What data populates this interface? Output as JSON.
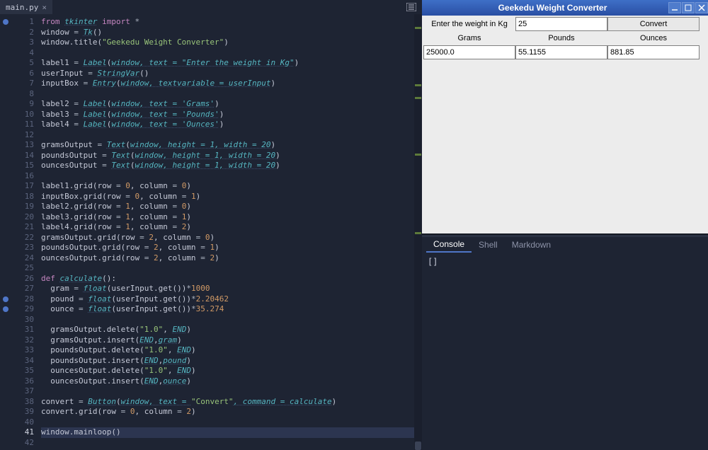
{
  "editor": {
    "tab_name": "main.py",
    "current_line": 41,
    "breakpoints": [
      1,
      28,
      29
    ],
    "scrollbar": {
      "marks_pct": [
        3,
        16,
        19,
        32,
        50
      ],
      "thumb_top_pct": 98,
      "thumb_height_pct": 2
    },
    "lines": [
      {
        "n": 1,
        "html": "<span class='kw'>from</span> <span class='fn'>tkinter</span> <span class='kw'>import</span> <span class='op'>*</span>"
      },
      {
        "n": 2,
        "html": "window <span class='op'>=</span> <span class='fn'>Tk</span>()"
      },
      {
        "n": 3,
        "html": "window.title(<span class='str'>\"Geekedu Weight Converter\"</span>)"
      },
      {
        "n": 4,
        "html": ""
      },
      {
        "n": 5,
        "html": "label1 <span class='op'>=</span> <span class='fn'>Label</span>(<span class='fn ul'>window, text = \"Enter the weight in Kg\"</span>)"
      },
      {
        "n": 6,
        "html": "userInput <span class='op'>=</span> <span class='fn'>StringVar</span>()"
      },
      {
        "n": 7,
        "html": "inputBox <span class='op'>=</span> <span class='fn'>Entry</span>(<span class='fn ul'>window, textvariable = userInput</span>)"
      },
      {
        "n": 8,
        "html": ""
      },
      {
        "n": 9,
        "html": "label2 <span class='op'>=</span> <span class='fn'>Label</span>(<span class='fn ul'>window, text = 'Grams'</span>)"
      },
      {
        "n": 10,
        "html": "label3 <span class='op'>=</span> <span class='fn'>Label</span>(<span class='fn ul'>window, text = 'Pounds'</span>)"
      },
      {
        "n": 11,
        "html": "label4 <span class='op'>=</span> <span class='fn'>Label</span>(<span class='fn ul'>window, text = 'Ounces'</span>)"
      },
      {
        "n": 12,
        "html": ""
      },
      {
        "n": 13,
        "html": "gramsOutput <span class='op'>=</span> <span class='fn'>Text</span>(<span class='fn ul'>window, height = 1, width = 20</span>)"
      },
      {
        "n": 14,
        "html": "poundsOutput <span class='op'>=</span> <span class='fn'>Text</span>(<span class='fn ul'>window, height = 1, width = 20</span>)"
      },
      {
        "n": 15,
        "html": "ouncesOutput <span class='op'>=</span> <span class='fn'>Text</span>(<span class='fn ul'>window, height = 1, width = 20</span>)"
      },
      {
        "n": 16,
        "html": ""
      },
      {
        "n": 17,
        "html": "label1.grid(row <span class='op'>=</span> <span class='num'>0</span>, column <span class='op'>=</span> <span class='num'>0</span>)"
      },
      {
        "n": 18,
        "html": "inputBox.grid(row <span class='op'>=</span> <span class='num'>0</span>, column <span class='op'>=</span> <span class='num'>1</span>)"
      },
      {
        "n": 19,
        "html": "label2.grid(row <span class='op'>=</span> <span class='num'>1</span>, column <span class='op'>=</span> <span class='num'>0</span>)"
      },
      {
        "n": 20,
        "html": "label3.grid(row <span class='op'>=</span> <span class='num'>1</span>, column <span class='op'>=</span> <span class='num'>1</span>)"
      },
      {
        "n": 21,
        "html": "label4.grid(row <span class='op'>=</span> <span class='num'>1</span>, column <span class='op'>=</span> <span class='num'>2</span>)"
      },
      {
        "n": 22,
        "html": "gramsOutput.grid(row <span class='op'>=</span> <span class='num'>2</span>, column <span class='op'>=</span> <span class='num'>0</span>)"
      },
      {
        "n": 23,
        "html": "poundsOutput.grid(row <span class='op'>=</span> <span class='num'>2</span>, column <span class='op'>=</span> <span class='num'>1</span>)"
      },
      {
        "n": 24,
        "html": "ouncesOutput.grid(row <span class='op'>=</span> <span class='num'>2</span>, column <span class='op'>=</span> <span class='num'>2</span>)"
      },
      {
        "n": 25,
        "html": ""
      },
      {
        "n": 26,
        "html": "<span class='kw'>def</span> <span class='fn'>calculate</span>():"
      },
      {
        "n": 27,
        "html": "  gram <span class='op'>=</span> <span class='fn'>float</span>(userInput.get())<span class='op'>*</span><span class='num'>1000</span>"
      },
      {
        "n": 28,
        "html": "  pound <span class='op'>=</span> <span class='fn'>float</span>(userInput.get())<span class='op'>*</span><span class='num'>2.20462</span>"
      },
      {
        "n": 29,
        "html": "  ounce <span class='op'>=</span> <span class='fn'>float</span>(userInput.get())<span class='op'>*</span><span class='num'>35.274</span>"
      },
      {
        "n": 30,
        "html": ""
      },
      {
        "n": 31,
        "html": "  gramsOutput.delete(<span class='str'>\"1.0\"</span>, <span class='fn ul'>END</span>)"
      },
      {
        "n": 32,
        "html": "  gramsOutput.insert(<span class='fn ul'>END</span>,<span class='fn ul'>gram</span>)"
      },
      {
        "n": 33,
        "html": "  poundsOutput.delete(<span class='str'>\"1.0\"</span>, <span class='fn ul'>END</span>)"
      },
      {
        "n": 34,
        "html": "  poundsOutput.insert(<span class='fn ul'>END</span>,<span class='fn ul'>pound</span>)"
      },
      {
        "n": 35,
        "html": "  ouncesOutput.delete(<span class='str'>\"1.0\"</span>, <span class='fn ul'>END</span>)"
      },
      {
        "n": 36,
        "html": "  ouncesOutput.insert(<span class='fn ul'>END</span>,<span class='fn ul'>ounce</span>)"
      },
      {
        "n": 37,
        "html": ""
      },
      {
        "n": 38,
        "html": "convert <span class='op'>=</span> <span class='fn'>Button</span>(<span class='fn ul'>window, text = </span><span class='str'>\"Convert\"</span><span class='fn ul'>, command = calculate</span>)"
      },
      {
        "n": 39,
        "html": "convert.grid(row <span class='op'>=</span> <span class='num'>0</span>, column <span class='op'>=</span> <span class='num'>2</span>)"
      },
      {
        "n": 40,
        "html": ""
      },
      {
        "n": 41,
        "html": "window.mainloop()"
      },
      {
        "n": 42,
        "html": ""
      }
    ]
  },
  "tk": {
    "title": "Geekedu Weight Converter",
    "label_prompt": "Enter the weight in Kg",
    "input_value": "25",
    "convert_label": "Convert",
    "headers": {
      "grams": "Grams",
      "pounds": "Pounds",
      "ounces": "Ounces"
    },
    "outputs": {
      "grams": "25000.0",
      "pounds": "55.1155",
      "ounces": "881.85"
    }
  },
  "console": {
    "tabs": {
      "console": "Console",
      "shell": "Shell",
      "markdown": "Markdown"
    },
    "output": "[]"
  }
}
